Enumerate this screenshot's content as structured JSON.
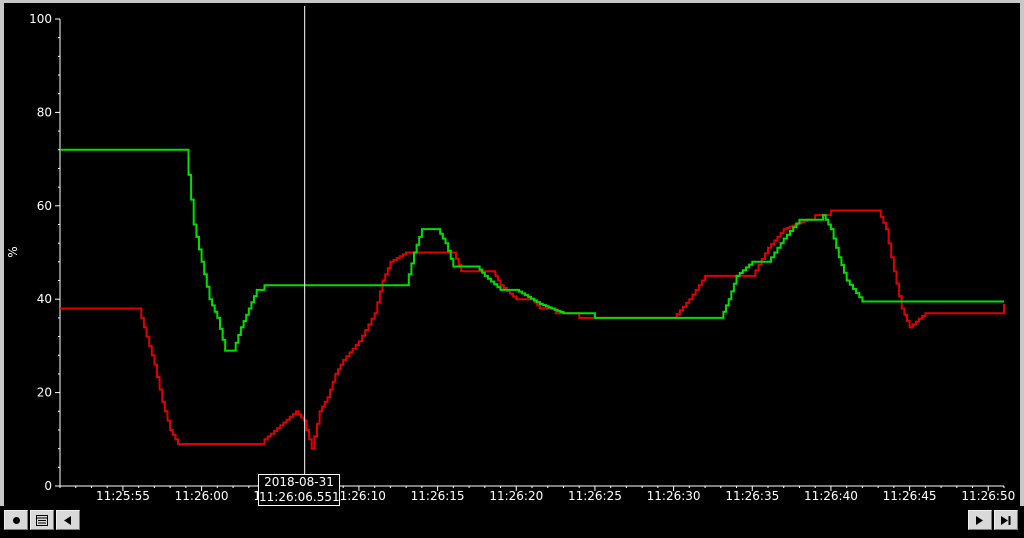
{
  "chart_data": {
    "type": "line",
    "title": "",
    "xlabel": "",
    "ylabel": "%",
    "ylim": [
      0,
      100
    ],
    "yticks": [
      0,
      20,
      40,
      60,
      80,
      100
    ],
    "xlim": [
      "11:25:51",
      "11:26:51"
    ],
    "xticks": [
      "11:25:55",
      "11:26:00",
      "11:26:05",
      "11:26:10",
      "11:26:15",
      "11:26:20",
      "11:26:25",
      "11:26:30",
      "11:26:35",
      "11:26:40",
      "11:26:45",
      "11:26:50"
    ],
    "grid": false,
    "series": [
      {
        "color": "#e00000",
        "x": [
          "11:25:51.0",
          "11:25:56.0",
          "11:25:56.5",
          "11:25:57.0",
          "11:25:57.5",
          "11:25:58.0",
          "11:25:58.5",
          "11:25:59.0",
          "11:26:01.0",
          "11:26:03.0",
          "11:26:04.0",
          "11:26:05.0",
          "11:26:06.0",
          "11:26:06.5",
          "11:26:07.0",
          "11:26:07.5",
          "11:26:08.0",
          "11:26:08.5",
          "11:26:09.0",
          "11:26:10.0",
          "11:26:11.0",
          "11:26:11.5",
          "11:26:12.0",
          "11:26:13.0",
          "11:26:14.0",
          "11:26:16.0",
          "11:26:16.5",
          "11:26:18.5",
          "11:26:19.0",
          "11:26:20.0",
          "11:26:21.0",
          "11:26:21.5",
          "11:26:22.5",
          "11:26:24.0",
          "11:26:25.0",
          "11:26:30.0",
          "11:26:31.0",
          "11:26:32.0",
          "11:26:35.0",
          "11:26:36.0",
          "11:26:37.0",
          "11:26:38.5",
          "11:26:39.0",
          "11:26:40.0",
          "11:26:42.0",
          "11:26:43.0",
          "11:26:43.5",
          "11:26:44.0",
          "11:26:44.5",
          "11:26:45.0",
          "11:26:46.0",
          "11:26:51.0"
        ],
        "y": [
          38,
          38,
          32,
          26,
          18,
          12,
          9,
          9,
          9,
          9,
          10,
          13,
          16,
          14,
          8,
          16,
          19,
          24,
          27,
          31,
          37,
          44,
          48,
          50,
          50,
          50,
          46,
          46,
          43,
          40,
          40,
          38,
          37,
          36,
          36,
          36,
          40,
          45,
          45,
          51,
          55,
          57,
          58,
          59,
          59,
          59,
          55,
          46,
          38,
          34,
          37,
          39
        ]
      },
      {
        "color": "#00e000",
        "x": [
          "11:25:51.0",
          "11:25:59.0",
          "11:25:59.5",
          "11:26:00.0",
          "11:26:00.5",
          "11:26:01.0",
          "11:26:01.5",
          "11:26:02.0",
          "11:26:02.5",
          "11:26:03.0",
          "11:26:03.5",
          "11:26:04.0",
          "11:26:13.0",
          "11:26:13.5",
          "11:26:14.0",
          "11:26:15.0",
          "11:26:15.5",
          "11:26:16.0",
          "11:26:17.5",
          "11:26:18.0",
          "11:26:19.0",
          "11:26:20.0",
          "11:26:21.5",
          "11:26:23.0",
          "11:26:25.0",
          "11:26:33.0",
          "11:26:33.5",
          "11:26:34.0",
          "11:26:35.0",
          "11:26:36.0",
          "11:26:37.0",
          "11:26:38.0",
          "11:26:39.5",
          "11:26:40.0",
          "11:26:40.5",
          "11:26:41.0",
          "11:26:42.0",
          "11:26:51.0"
        ],
        "y": [
          72,
          72,
          56,
          48,
          40,
          36,
          29,
          29,
          34,
          38,
          42,
          43,
          43,
          50,
          55,
          55,
          52,
          47,
          47,
          45,
          42,
          42,
          39,
          37,
          36,
          36,
          40,
          45,
          48,
          48,
          53,
          57,
          58,
          55,
          49,
          44,
          39.5,
          39.5
        ]
      }
    ],
    "cursor": {
      "x": "11:26:06.551",
      "date_label": "2018-08-31",
      "time_label": "11:26:06.551"
    }
  },
  "controls": {
    "record_icon": "record-dot-icon",
    "calendar_icon": "calendar-icon",
    "prev_icon": "triangle-left-icon",
    "play_icon": "triangle-right-icon",
    "end_icon": "skip-to-end-icon"
  }
}
